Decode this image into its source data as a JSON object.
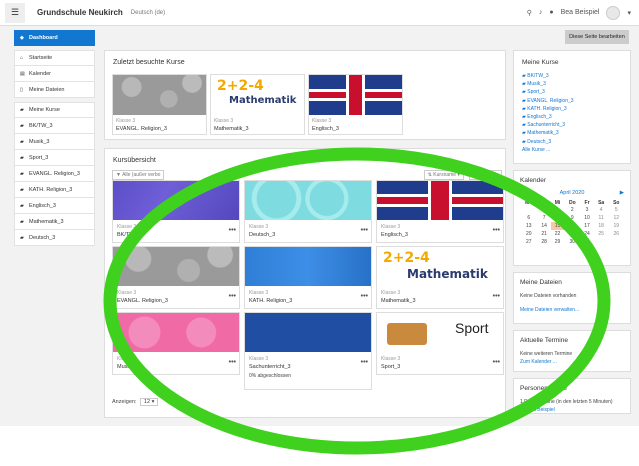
{
  "topbar": {
    "site": "Grundschule Neukirch",
    "lang": "Deutsch (de)",
    "user": "Bea Beispiel"
  },
  "nav": {
    "items": [
      {
        "label": "Dashboard",
        "icon": "dashboard-icon",
        "active": true
      },
      {
        "label": "Startseite",
        "icon": "home-icon"
      },
      {
        "label": "Kalender",
        "icon": "calendar-icon"
      },
      {
        "label": "Meine Dateien",
        "icon": "file-icon"
      },
      {
        "label": "Meine Kurse",
        "icon": "graduation-icon"
      },
      {
        "label": "BK/TW_3",
        "icon": "graduation-icon"
      },
      {
        "label": "Musik_3",
        "icon": "graduation-icon"
      },
      {
        "label": "Sport_3",
        "icon": "graduation-icon"
      },
      {
        "label": "EVANGL. Religion_3",
        "icon": "graduation-icon"
      },
      {
        "label": "KATH. Religion_3",
        "icon": "graduation-icon"
      },
      {
        "label": "Englisch_3",
        "icon": "graduation-icon"
      },
      {
        "label": "Mathematik_3",
        "icon": "graduation-icon"
      },
      {
        "label": "Deutsch_3",
        "icon": "graduation-icon"
      }
    ]
  },
  "edit_button": "Diese Seite bearbeiten",
  "recent": {
    "title": "Zuletzt besuchte Kurse",
    "courses": [
      {
        "cat": "Klasse 3",
        "name": "EVANGL. Religion_3"
      },
      {
        "cat": "Klasse 3",
        "name": "Mathematik_3"
      },
      {
        "cat": "Klasse 3",
        "name": "Englisch_3"
      }
    ]
  },
  "overview": {
    "title": "Kursübersicht",
    "filter": "Alle (außer verbo",
    "sort": "Kursname",
    "view": "Kachel",
    "show_label": "Anzeigen:",
    "show_value": "12",
    "progress": "0% abgeschlossen",
    "tiles": [
      {
        "cat": "Klasse 3",
        "name": "BK/TW_3"
      },
      {
        "cat": "Klasse 3",
        "name": "Deutsch_3"
      },
      {
        "cat": "Klasse 3",
        "name": "Englisch_3"
      },
      {
        "cat": "Klasse 3",
        "name": "EVANGL. Religion_3"
      },
      {
        "cat": "Klasse 3",
        "name": "KATH. Religion_3"
      },
      {
        "cat": "Klasse 3",
        "name": "Mathematik_3"
      },
      {
        "cat": "Klasse 3",
        "name": "Musik_3"
      },
      {
        "cat": "Klasse 3",
        "name": "Sachunterricht_3"
      },
      {
        "cat": "Klasse 3",
        "name": "Sport_3"
      }
    ],
    "math_img": {
      "n": "2+2-4",
      "w": "Mathematik"
    },
    "sport_img": "Sport"
  },
  "mycourses": {
    "title": "Meine Kurse",
    "items": [
      "BK/TW_3",
      "Musik_3",
      "Sport_3",
      "EVANGL. Religion_3",
      "KATH. Religion_3",
      "Englisch_3",
      "Sachunterricht_3",
      "Mathematik_3",
      "Deutsch_3"
    ],
    "all": "Alle Kurse ..."
  },
  "calendar": {
    "title": "Kalender",
    "month": "April 2020",
    "days": [
      "Mo",
      "Di",
      "Mi",
      "Do",
      "Fr",
      "Sa",
      "So"
    ],
    "weeks": [
      [
        "",
        "",
        "1",
        "2",
        "3",
        "4",
        "5"
      ],
      [
        "6",
        "7",
        "8",
        "9",
        "10",
        "11",
        "12"
      ],
      [
        "13",
        "14",
        "15",
        "16",
        "17",
        "18",
        "19"
      ],
      [
        "20",
        "21",
        "22",
        "23",
        "24",
        "25",
        "26"
      ],
      [
        "27",
        "28",
        "29",
        "30",
        "",
        "",
        ""
      ]
    ]
  },
  "files": {
    "title": "Meine Dateien",
    "none": "Keine Dateien vorhanden",
    "manage": "Meine Dateien verwalten..."
  },
  "events": {
    "title": "Aktuelle Termine",
    "none": "Keine weiteren Termine",
    "go": "Zum Kalender ..."
  },
  "online": {
    "title": "Personen online",
    "count": "1 Person online (in den letzten 5 Minuten)",
    "person": "Bea Beispiel"
  }
}
